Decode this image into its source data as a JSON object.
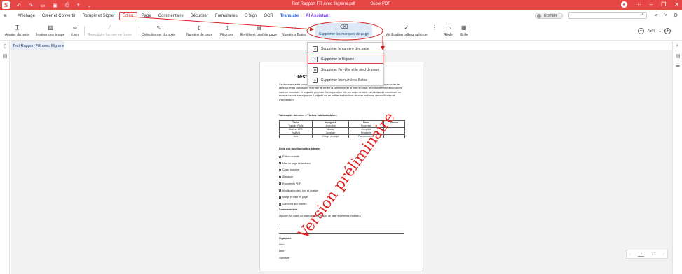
{
  "window": {
    "title": "Test Rapport FR avec filigrane.pdf",
    "app_name": "Skole PDF"
  },
  "colors": {
    "brand_red": "#e64646",
    "translate_blue": "#2b63d9",
    "ai_purple": "#7b3be8",
    "highlight_blue": "#dde9f7",
    "watermark_red": "#e02222",
    "annotation_red": "#d62020"
  },
  "quick_access": [
    "arrow-left-icon",
    "arrow-right-icon",
    "folder-icon",
    "save-icon",
    "print-icon",
    "plus-icon",
    "chevron-down-icon"
  ],
  "menu": {
    "tabs": [
      "Affichage",
      "Créer et Convertir",
      "Remplir et Signer",
      "Éditer",
      "Page",
      "Commentaire",
      "Sécuriser",
      "Formulaires",
      "E Sign",
      "OCR",
      "Translate",
      "AI Assistant"
    ],
    "active_tab": "Éditer",
    "edit_toggle_label": "ÉDITER"
  },
  "toolbar": {
    "add_text": "Ajouter du texte",
    "insert_image": "Insérer une image",
    "link": "Lien",
    "reproduce_format": "Reproduire la mise en forme",
    "select_text": "Sélectionner du texte",
    "page_number": "Numéro de page",
    "watermark": "Filigrane",
    "header_footer": "En-tête et pied de page",
    "bates_numbers": "Numéros Bates",
    "remove_page_marks": "Supprimer les marques de page",
    "spell_check": "Vérification orthographique",
    "ruler": "Règle",
    "grid": "Grille",
    "zoom": "75%"
  },
  "dropdown": {
    "items": [
      "Supprimer le numéro des page",
      "Supprimer le filigrane",
      "Supprimer l'en-tête et le pied de page",
      "Supprimer les numéros Bates"
    ],
    "selected": "Supprimer le filigrane"
  },
  "document": {
    "tab_label": "Test Rapport FR avec filigrane",
    "title": "Test R",
    "intro": "Ce document a été conçu pour tester les fonctionnalités d'un éditeur PDF, notamment les cases à cocher, les tableaux et les signatures. Il permet de vérifier la cohérence de la mise en page, le comportement des champs dans un formulaire et la qualité générale. Il comprend un titre, un corps de texte, un tableau de données et un espace réservé à la signature. L'objectif est de valider les fonctions de mise en forme, de modification et d'exportation.",
    "table_title": "Tableau de données – Tâches hebdomadaires",
    "table_headers": [
      "Tâche",
      "Assigné à",
      "Statut",
      "Comme"
    ],
    "table_rows": [
      [
        "Traduire FAQs",
        "Jenevieve",
        "Progresse",
        ""
      ],
      [
        "Analyse SEO",
        "Nicolas",
        "Complété",
        ""
      ],
      [
        "Test A/B",
        "Jonathan",
        "En attente",
        ""
      ],
      [
        "Avis",
        "Chargé du projet",
        "Pas commencé",
        ""
      ]
    ],
    "checklist_title": "Liste des fonctionnalités à tester",
    "checklist": [
      "Édition de texte",
      "Mise en page de tableaux",
      "Cases à cocher",
      "Signature",
      "Exporter en PDF",
      "Modification de la font et du style",
      "Marge et mise en page",
      "Conforme aux normes"
    ],
    "comments_title": "Commentaires",
    "comments_text": "(Ajoutez vos notes ou observations à propos de cette expérience d'édition.)",
    "signature_title": "Signature",
    "signature_fields": [
      "Nom :",
      "Date :",
      "Signature :"
    ],
    "watermark_text": "Version préliminaire"
  },
  "pager": {
    "current": "1",
    "total": "/ 1"
  }
}
